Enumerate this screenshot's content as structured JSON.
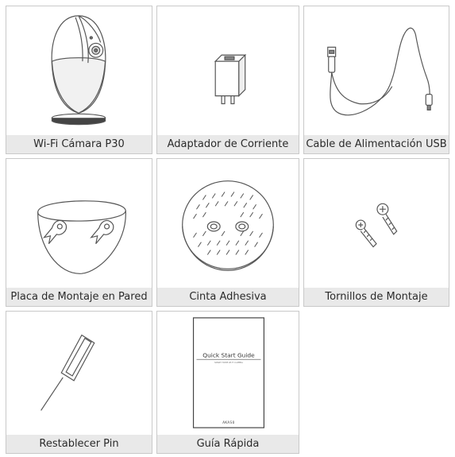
{
  "items": [
    {
      "label": "Wi-Fi Cámara P30",
      "icon": "security-camera-icon"
    },
    {
      "label": "Adaptador de Corriente",
      "icon": "power-adapter-icon"
    },
    {
      "label": "Cable de Alimentación USB",
      "icon": "usb-cable-icon"
    },
    {
      "label": "Placa de Montaje en Pared",
      "icon": "wall-mount-plate-icon"
    },
    {
      "label": "Cinta Adhesiva",
      "icon": "adhesive-tape-icon"
    },
    {
      "label": "Tornillos de Montaje",
      "icon": "mounting-screws-icon"
    },
    {
      "label": "Restablecer Pin",
      "icon": "reset-pin-icon"
    },
    {
      "label": "Guía Rápida",
      "icon": "quick-guide-icon"
    }
  ],
  "guide": {
    "title": "Quick Start Guide",
    "subtitle": "SMART HOME WI-FI CAMERA",
    "brand": "AKASO"
  },
  "colors": {
    "border": "#c9c9c9",
    "caption_bg": "#e9e9e9",
    "caption_text": "#2b2b2b",
    "line_art": "#555555"
  }
}
